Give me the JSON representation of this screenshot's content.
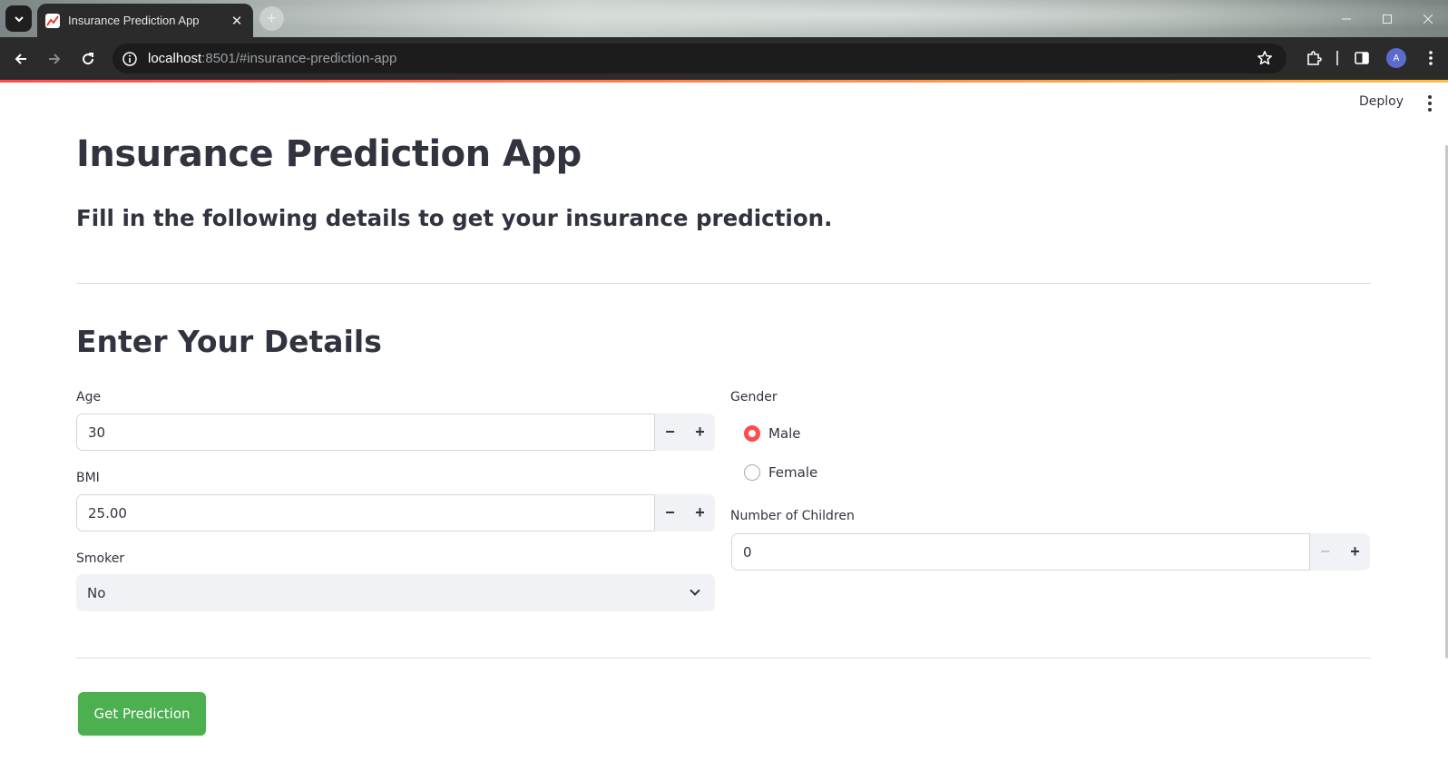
{
  "browser": {
    "tab_title": "Insurance Prediction App",
    "tab_close": "✕",
    "new_tab": "+",
    "url_host": "localhost",
    "url_rest": ":8501/#insurance-prediction-app",
    "profile_initial": "A"
  },
  "app_header": {
    "deploy_label": "Deploy"
  },
  "page": {
    "title": "Insurance Prediction App",
    "subtitle": "Fill in the following details to get your insurance prediction.",
    "section_title": "Enter Your Details"
  },
  "form": {
    "age": {
      "label": "Age",
      "value": "30",
      "minus": "−",
      "plus": "+"
    },
    "bmi": {
      "label": "BMI",
      "value": "25.00",
      "minus": "−",
      "plus": "+"
    },
    "smoker": {
      "label": "Smoker",
      "selected": "No"
    },
    "gender": {
      "label": "Gender",
      "options": [
        {
          "label": "Male",
          "selected": true
        },
        {
          "label": "Female",
          "selected": false
        }
      ]
    },
    "children": {
      "label": "Number of Children",
      "value": "0",
      "minus": "−",
      "plus": "+"
    },
    "submit_label": "Get Prediction"
  },
  "colors": {
    "accent": "#ff4b4b",
    "button": "#4caf50",
    "text": "#31333f"
  }
}
